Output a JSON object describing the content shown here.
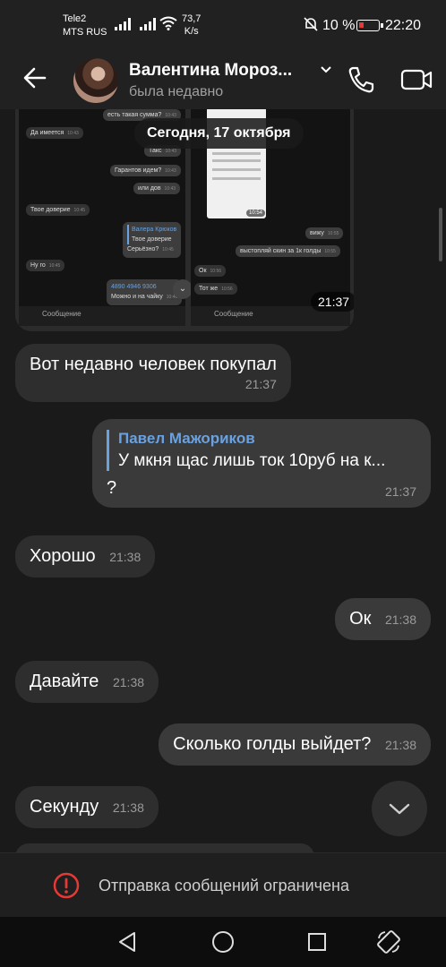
{
  "status": {
    "carrier1": "Tele2",
    "carrier2": "MTS RUS",
    "speed_value": "73,7",
    "speed_unit": "K/s",
    "battery": "10 %",
    "clock": "22:20"
  },
  "header": {
    "name": "Валентина Мороз...",
    "last_seen": "была недавно"
  },
  "date_separator": "Сегодня, 17 октября",
  "photo": {
    "time": "21:37",
    "left_screenshot": {
      "messages": [
        {
          "text": "есть такая сумма?",
          "time": "10:43",
          "own": true
        },
        {
          "text": "Да имеется",
          "time": "10:43",
          "own": false
        },
        {
          "text": "Такс",
          "time": "10:43",
          "own": true
        },
        {
          "text": "Гарантов идем?",
          "time": "10:43",
          "own": true
        },
        {
          "text": "или дов",
          "time": "10:43",
          "own": true
        },
        {
          "text": "Твое доверие",
          "time": "10:45",
          "own": false
        },
        {
          "text": "Валера Крюков",
          "time": "",
          "own": true
        },
        {
          "text": "Твое доверие",
          "time": "",
          "own": true
        },
        {
          "text": "Серьёзно?",
          "time": "10:45",
          "own": true
        },
        {
          "text": "Ну го",
          "time": "10:45",
          "own": false
        },
        {
          "text": "4890 4946 9306",
          "time": "",
          "own": true
        },
        {
          "text": "Можно и на чайку",
          "time": "10:46",
          "own": true
        }
      ],
      "input_placeholder": "Сообщение"
    },
    "right_screenshot": {
      "mini_time": "10:54",
      "messages": [
        {
          "text": "вижу",
          "time": "10:55",
          "own": true
        },
        {
          "text": "выстопляй скин за 1к голды",
          "time": "10:55",
          "own": true
        },
        {
          "text": "Ок",
          "time": "10:56",
          "own": false
        },
        {
          "text": "Тот же",
          "time": "10:56",
          "own": false
        }
      ],
      "input_placeholder": "Сообщение"
    }
  },
  "messages": [
    {
      "direction": "in",
      "text": "Вот недавно человек покупал",
      "time": "21:37"
    },
    {
      "direction": "out",
      "reply_name": "Павел Мажориков",
      "reply_text": "У мкня щас лишь ток 10руб на к...",
      "text": "?",
      "time": "21:37"
    },
    {
      "direction": "in",
      "text": "Хорошо",
      "time": "21:38"
    },
    {
      "direction": "out",
      "text": "Ок",
      "time": "21:38"
    },
    {
      "direction": "in",
      "text": "Давайте",
      "time": "21:38"
    },
    {
      "direction": "out",
      "text": "Сколько голды выйдет?",
      "time": "21:38"
    },
    {
      "direction": "in",
      "text": "Секунду",
      "time": "21:38"
    }
  ],
  "restricted_notice": "Отправка сообщений ограничена",
  "colors": {
    "background": "#1a1a1a",
    "bubble_in": "#2e2e2e",
    "bubble_out": "#3a3a3a",
    "reply_accent": "#6aa1e0",
    "warning": "#e53935"
  },
  "icons": [
    "back-arrow-icon",
    "chevron-down-icon",
    "phone-icon",
    "video-camera-icon",
    "warning-icon",
    "scroll-down-icon",
    "nav-back-icon",
    "nav-home-icon",
    "nav-recents-icon",
    "rotate-icon"
  ]
}
